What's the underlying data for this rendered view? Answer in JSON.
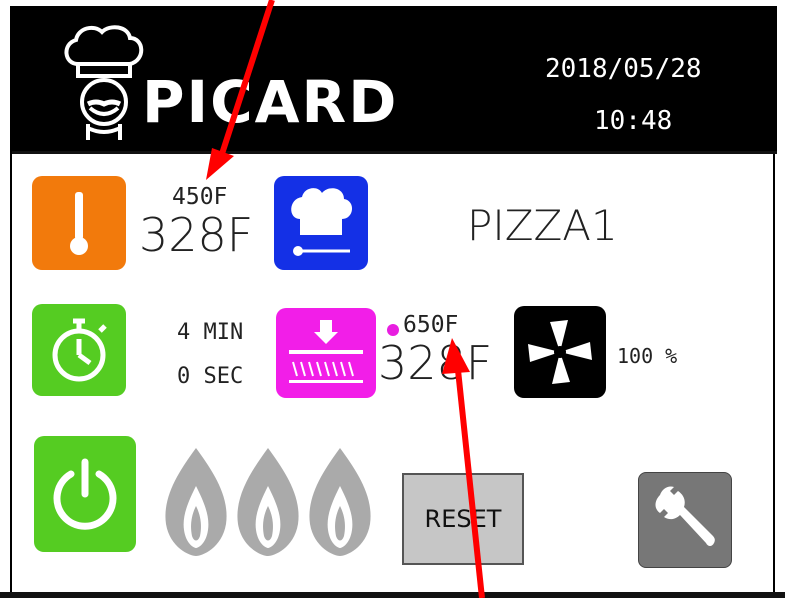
{
  "header": {
    "brand": "PICARD",
    "date": "2018/05/28",
    "time": "10:48"
  },
  "temperature": {
    "setpoint": "450F",
    "current": "328F",
    "icon": "thermometer-icon",
    "color": "#f27a0c"
  },
  "recipe": {
    "name": "PIZZA1",
    "icon": "chef-hat-icon",
    "color": "#1430e6"
  },
  "timer": {
    "minutes": "4 MIN",
    "seconds": "0 SEC",
    "icon": "stopwatch-icon",
    "color": "#55cc22"
  },
  "deck": {
    "setpoint": "650F",
    "current": "328F",
    "indicator_color": "#e81ee0",
    "icon": "deck-heat-icon",
    "color": "#f21ee8"
  },
  "fan": {
    "speed": "100 %",
    "icon": "fan-icon"
  },
  "controls": {
    "power_icon": "power-icon",
    "power_color": "#55cc22",
    "flame_icon": "flame-icon",
    "flame_count": 3,
    "reset_label": "RESET",
    "settings_icon": "wrench-icon"
  },
  "annotation_color": "#ff0000"
}
